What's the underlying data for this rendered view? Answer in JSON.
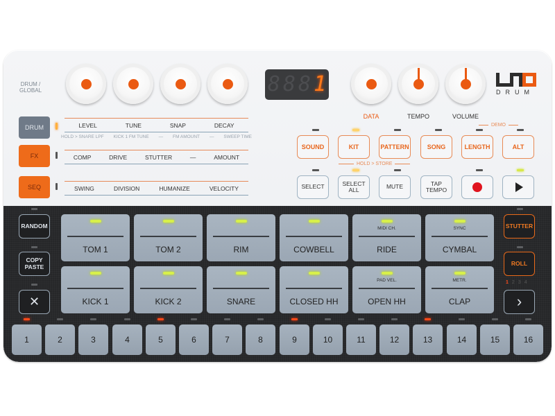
{
  "device": {
    "brand_word": "DRUM",
    "display_digits": [
      "8",
      "8",
      "8",
      "1"
    ],
    "active_digit_index": 3
  },
  "knob_section": {
    "group_label_line1": "DRUM /",
    "group_label_line2": "GLOBAL",
    "knobs": [
      {
        "name": "drum-param-knob-1",
        "indicator": "dot"
      },
      {
        "name": "drum-param-knob-2",
        "indicator": "dot"
      },
      {
        "name": "drum-param-knob-3",
        "indicator": "dot"
      },
      {
        "name": "drum-param-knob-4",
        "indicator": "dot"
      }
    ],
    "right_knobs": [
      {
        "label": "DATA",
        "indicator": "dot"
      },
      {
        "label": "TEMPO",
        "indicator": "needle"
      },
      {
        "label": "VOLUME",
        "indicator": "needle"
      }
    ]
  },
  "modes": [
    {
      "label": "DRUM",
      "led_on": true,
      "params": [
        "LEVEL",
        "TUNE",
        "SNAP",
        "DECAY"
      ],
      "sub": [
        "HOLD > SNARE LPF",
        "KICK 1 FM TUNE",
        "—",
        "FM AMOUNT",
        "—",
        "SWEEP TIME"
      ]
    },
    {
      "label": "FX",
      "led_on": false,
      "params": [
        "COMP",
        "DRIVE",
        "STUTTER",
        "—",
        "AMOUNT"
      ]
    },
    {
      "label": "SEQ",
      "led_on": false,
      "params": [
        "SWING",
        "DIVISION",
        "HUMANIZE",
        "VELOCITY"
      ]
    }
  ],
  "function_buttons": {
    "top_row": [
      {
        "label": "SOUND",
        "led": "off"
      },
      {
        "label": "KIT",
        "led": "on"
      },
      {
        "label": "PATTERN",
        "led": "off"
      },
      {
        "label": "SONG",
        "led": "off"
      },
      {
        "label": "LENGTH",
        "led": "off"
      },
      {
        "label": "ALT",
        "led": "off"
      }
    ],
    "demo_label": "DEMO",
    "hold_store_label": "HOLD > STORE",
    "bottom_row": [
      {
        "label1": "SELECT",
        "label2": "",
        "led": "off"
      },
      {
        "label1": "SELECT",
        "label2": "ALL",
        "led": "on"
      },
      {
        "label1": "MUTE",
        "label2": "",
        "led": "off"
      },
      {
        "label1": "TAP",
        "label2": "TEMPO",
        "led": "none"
      },
      {
        "label1": "",
        "label2": "",
        "icon": "record-icon",
        "led": "off"
      },
      {
        "label1": "",
        "label2": "",
        "icon": "play-icon",
        "led": "green"
      }
    ],
    "record_color": "#e0141e"
  },
  "left_dark_buttons": [
    {
      "label1": "RANDOM",
      "label2": ""
    },
    {
      "label1": "COPY",
      "label2": "PASTE"
    },
    {
      "label1": "✕",
      "label2": "",
      "icon": "delete-icon"
    }
  ],
  "right_dark_buttons": {
    "stutter": "STUTTER",
    "roll": "ROLL",
    "pages": [
      "1",
      "2",
      "3",
      "4"
    ],
    "active_page": "1",
    "next": "›"
  },
  "pads": [
    {
      "name": "TOM 1",
      "sub": ""
    },
    {
      "name": "TOM 2",
      "sub": ""
    },
    {
      "name": "RIM",
      "sub": ""
    },
    {
      "name": "COWBELL",
      "sub": ""
    },
    {
      "name": "RIDE",
      "sub": "MIDI CH."
    },
    {
      "name": "CYMBAL",
      "sub": "SYNC"
    },
    {
      "name": "KICK 1",
      "sub": ""
    },
    {
      "name": "KICK 2",
      "sub": ""
    },
    {
      "name": "SNARE",
      "sub": ""
    },
    {
      "name": "CLOSED HH",
      "sub": ""
    },
    {
      "name": "OPEN HH",
      "sub": "PAD VEL."
    },
    {
      "name": "CLAP",
      "sub": "METR."
    }
  ],
  "steps": {
    "labels": [
      "1",
      "2",
      "3",
      "4",
      "5",
      "6",
      "7",
      "8",
      "9",
      "10",
      "11",
      "12",
      "13",
      "14",
      "15",
      "16"
    ],
    "active": [
      1,
      5,
      9,
      13
    ]
  },
  "colors": {
    "accent_orange": "#ea5a12",
    "pad_led": "#d8f04a",
    "step_led_on": "#ff4a1a"
  }
}
